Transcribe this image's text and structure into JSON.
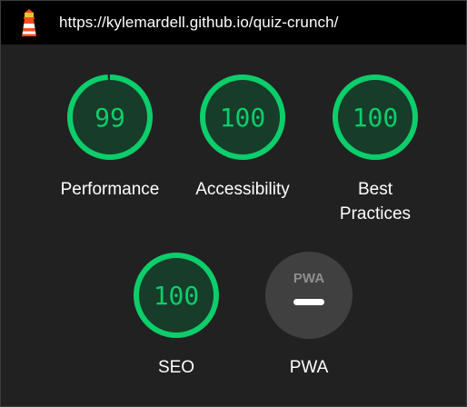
{
  "header": {
    "url": "https://kylemardell.github.io/quiz-crunch/",
    "logo_icon": "lighthouse-icon"
  },
  "colors": {
    "pass": "#0cce6b",
    "pass_fill": "#173c29",
    "pwa_gray": "#404040"
  },
  "categories": [
    {
      "label": "Performance",
      "score": "99",
      "fraction": 0.99
    },
    {
      "label": "Accessibility",
      "score": "100",
      "fraction": 1.0
    },
    {
      "label_line1": "Best",
      "label_line2": "Practices",
      "score": "100",
      "fraction": 1.0
    },
    {
      "label": "SEO",
      "score": "100",
      "fraction": 1.0
    },
    {
      "label": "PWA",
      "badge_text": "PWA",
      "score_icon": "dash-icon"
    }
  ]
}
